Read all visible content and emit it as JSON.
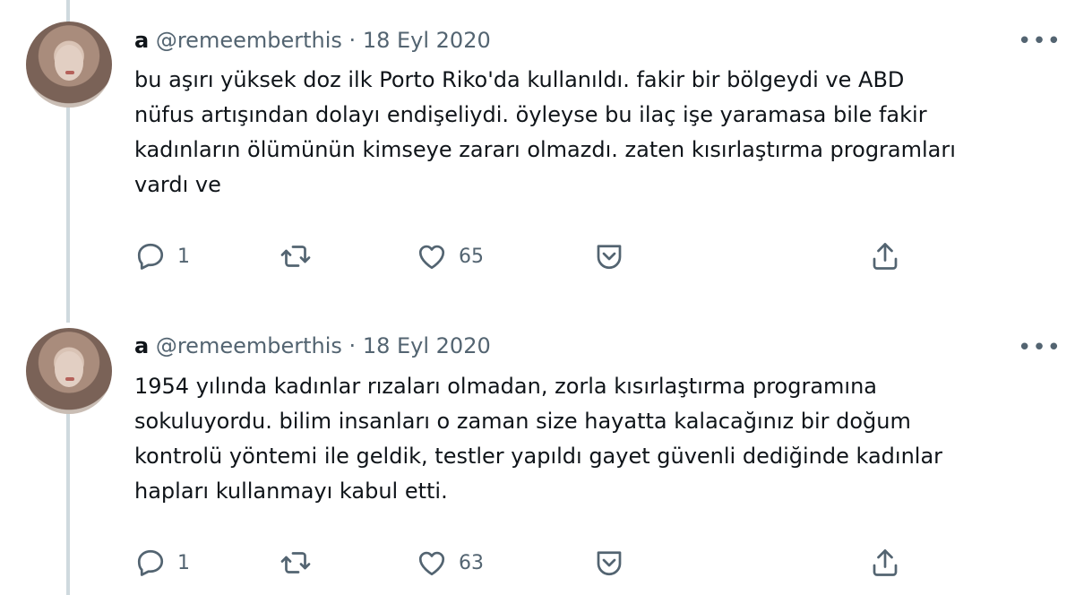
{
  "tweets": [
    {
      "name": "a",
      "handle": "@remeemberthis",
      "separator": "·",
      "date": "18 Eyl 2020",
      "more": "•••",
      "lines": [
        "bu aşırı yüksek doz ilk Porto Riko'da kullanıldı. fakir bir bölgeydi ve ABD",
        "nüfus artışından dolayı endişeliydi. öyleyse bu ilaç işe yaramasa bile fakir",
        "kadınların ölümünün kimseye zararı olmazdı. zaten kısırlaştırma programları",
        "vardı ve"
      ],
      "reply_count": "1",
      "like_count": "65"
    },
    {
      "name": "a",
      "handle": "@remeemberthis",
      "separator": "·",
      "date": "18 Eyl 2020",
      "more": "•••",
      "lines": [
        "1954 yılında kadınlar rızaları olmadan, zorla kısırlaştırma programına",
        "sokuluyordu. bilim insanları o zaman size hayatta kalacağınız bir doğum",
        "kontrolü yöntemi ile geldik, testler yapıldı gayet güvenli dediğinde kadınlar",
        "hapları kullanmayı kabul etti."
      ],
      "reply_count": "1",
      "like_count": "63"
    }
  ],
  "icons": [
    "reply-icon",
    "retweet-icon",
    "like-icon",
    "bookmark-icon",
    "share-icon",
    "more-icon"
  ],
  "colors": {
    "text": "#0f1419",
    "secondary": "#536471",
    "thread_line": "#cfd9de"
  }
}
